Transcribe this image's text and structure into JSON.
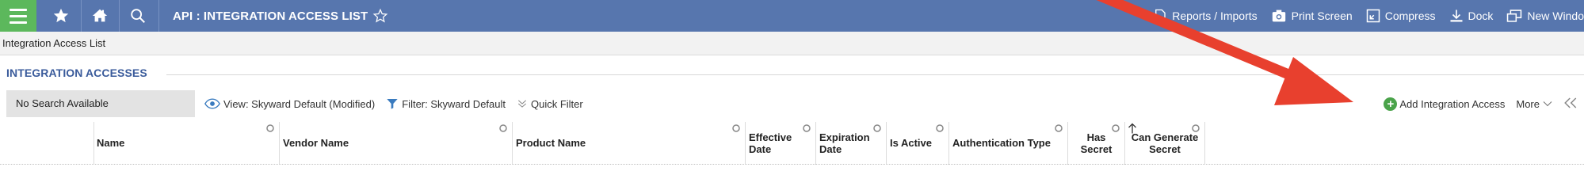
{
  "topbar": {
    "title": "API : INTEGRATION ACCESS LIST",
    "actions": [
      {
        "label": "Reports / Imports",
        "icon": "report-icon"
      },
      {
        "label": "Print Screen",
        "icon": "camera-icon"
      },
      {
        "label": "Compress",
        "icon": "compress-icon"
      },
      {
        "label": "Dock",
        "icon": "dock-icon"
      },
      {
        "label": "New Windo",
        "icon": "new-window-icon"
      }
    ],
    "colors": {
      "bar": "#5776ae",
      "menu": "#5cb85c"
    }
  },
  "breadcrumb": "Integration Access List",
  "section": {
    "title": "INTEGRATION ACCESSES"
  },
  "filters": {
    "search": "No Search Available",
    "view": "View: Skyward Default (Modified)",
    "filter": "Filter: Skyward Default",
    "quick_filter": "Quick Filter"
  },
  "tools": {
    "add": "Add Integration Access",
    "more": "More"
  },
  "table": {
    "columns": [
      {
        "line1": "Name",
        "line2": ""
      },
      {
        "line1": "Vendor Name",
        "line2": ""
      },
      {
        "line1": "Product Name",
        "line2": ""
      },
      {
        "line1": "Effective",
        "line2": "Date"
      },
      {
        "line1": "Expiration",
        "line2": "Date"
      },
      {
        "line1": "Is Active",
        "line2": ""
      },
      {
        "line1": "Authentication Type",
        "line2": ""
      },
      {
        "line1": "Has",
        "line2": "Secret"
      },
      {
        "line1": "Can Generate",
        "line2": "Secret"
      }
    ]
  },
  "annotation": {
    "color": "#e8402e"
  }
}
